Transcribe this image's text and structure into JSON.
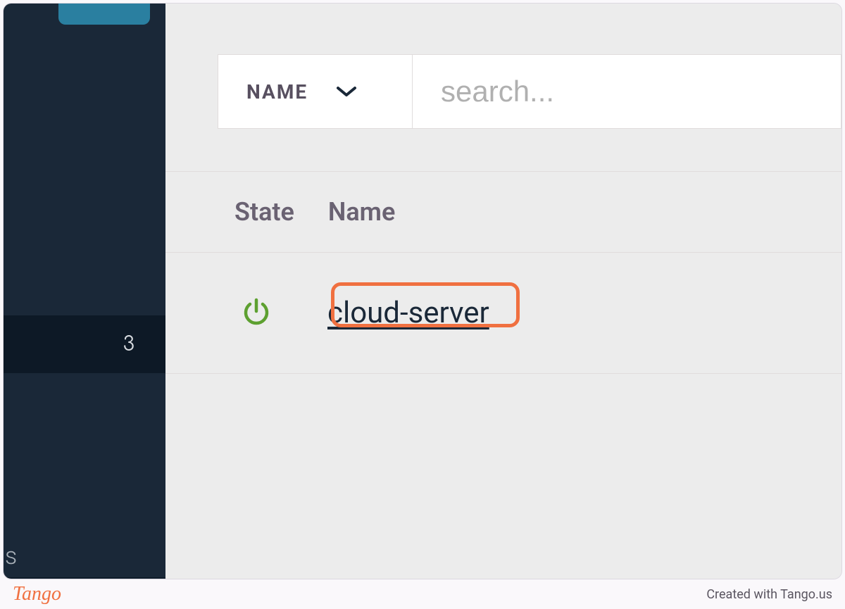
{
  "sidebar": {
    "badge_count": "3",
    "partial_letter": "s"
  },
  "filter": {
    "label": "NAME"
  },
  "search": {
    "placeholder": "search..."
  },
  "table": {
    "columns": {
      "state": "State",
      "name": "Name"
    },
    "rows": [
      {
        "state_icon": "power-on",
        "name": "cloud-server"
      }
    ]
  },
  "footer": {
    "brand": "Tango",
    "credit": "Created with Tango.us"
  },
  "colors": {
    "highlight": "#f07040",
    "sidebar_bg": "#1a2838",
    "power_green": "#5da030"
  }
}
